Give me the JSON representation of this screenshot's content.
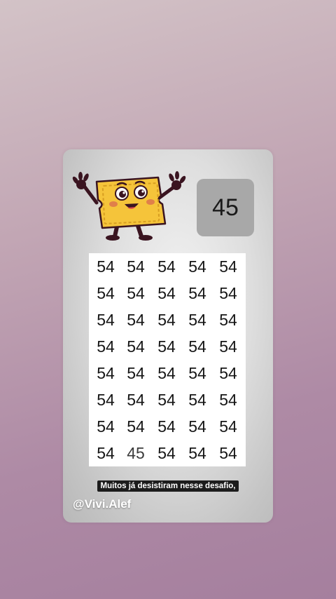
{
  "puzzle": {
    "target_number": "45",
    "grid": [
      [
        "54",
        "54",
        "54",
        "54",
        "54"
      ],
      [
        "54",
        "54",
        "54",
        "54",
        "54"
      ],
      [
        "54",
        "54",
        "54",
        "54",
        "54"
      ],
      [
        "54",
        "54",
        "54",
        "54",
        "54"
      ],
      [
        "54",
        "54",
        "54",
        "54",
        "54"
      ],
      [
        "54",
        "54",
        "54",
        "54",
        "54"
      ],
      [
        "54",
        "54",
        "54",
        "54",
        "54"
      ],
      [
        "54",
        "45",
        "54",
        "54",
        "54"
      ]
    ]
  },
  "caption": {
    "subtitle": "Muitos já desistiram nesse desafio,",
    "handle": "@Vivi.Alef"
  },
  "mascot": {
    "icon": "ticket-mascot-icon"
  },
  "colors": {
    "background_top": "#d3c3c7",
    "background_bottom": "#a57f9e",
    "answer_box": "#a8a8a8",
    "grid_background": "#ffffff",
    "mascot_body": "#f5c43a"
  }
}
